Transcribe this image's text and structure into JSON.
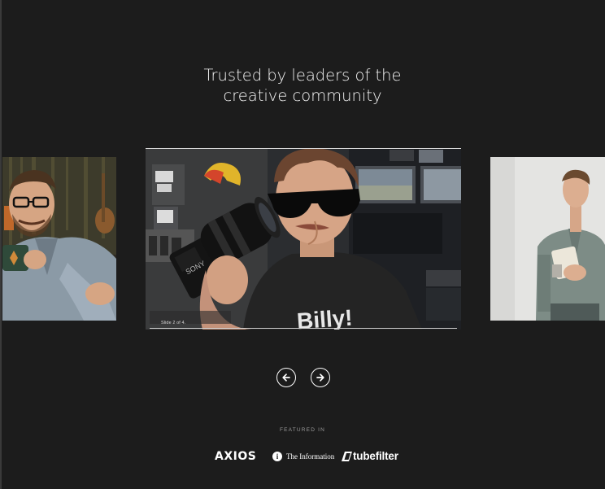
{
  "headline": {
    "line1": "Trusted by leaders of the",
    "line2": "creative community"
  },
  "carousel": {
    "slide_caption": "Slide 2 of 4.",
    "current_slide": 2,
    "total_slides": 4,
    "prev_icon": "arrow-left-icon",
    "next_icon": "arrow-right-icon"
  },
  "featured": {
    "label": "FEATURED IN",
    "logos": {
      "axios": "AXIOS",
      "the_information": "The Information",
      "the_information_mark": "i",
      "tubefilter": "tubefilter"
    }
  },
  "colors": {
    "background": "#1c1c1c",
    "text": "#ffffff",
    "muted": "#9a9a9a"
  }
}
